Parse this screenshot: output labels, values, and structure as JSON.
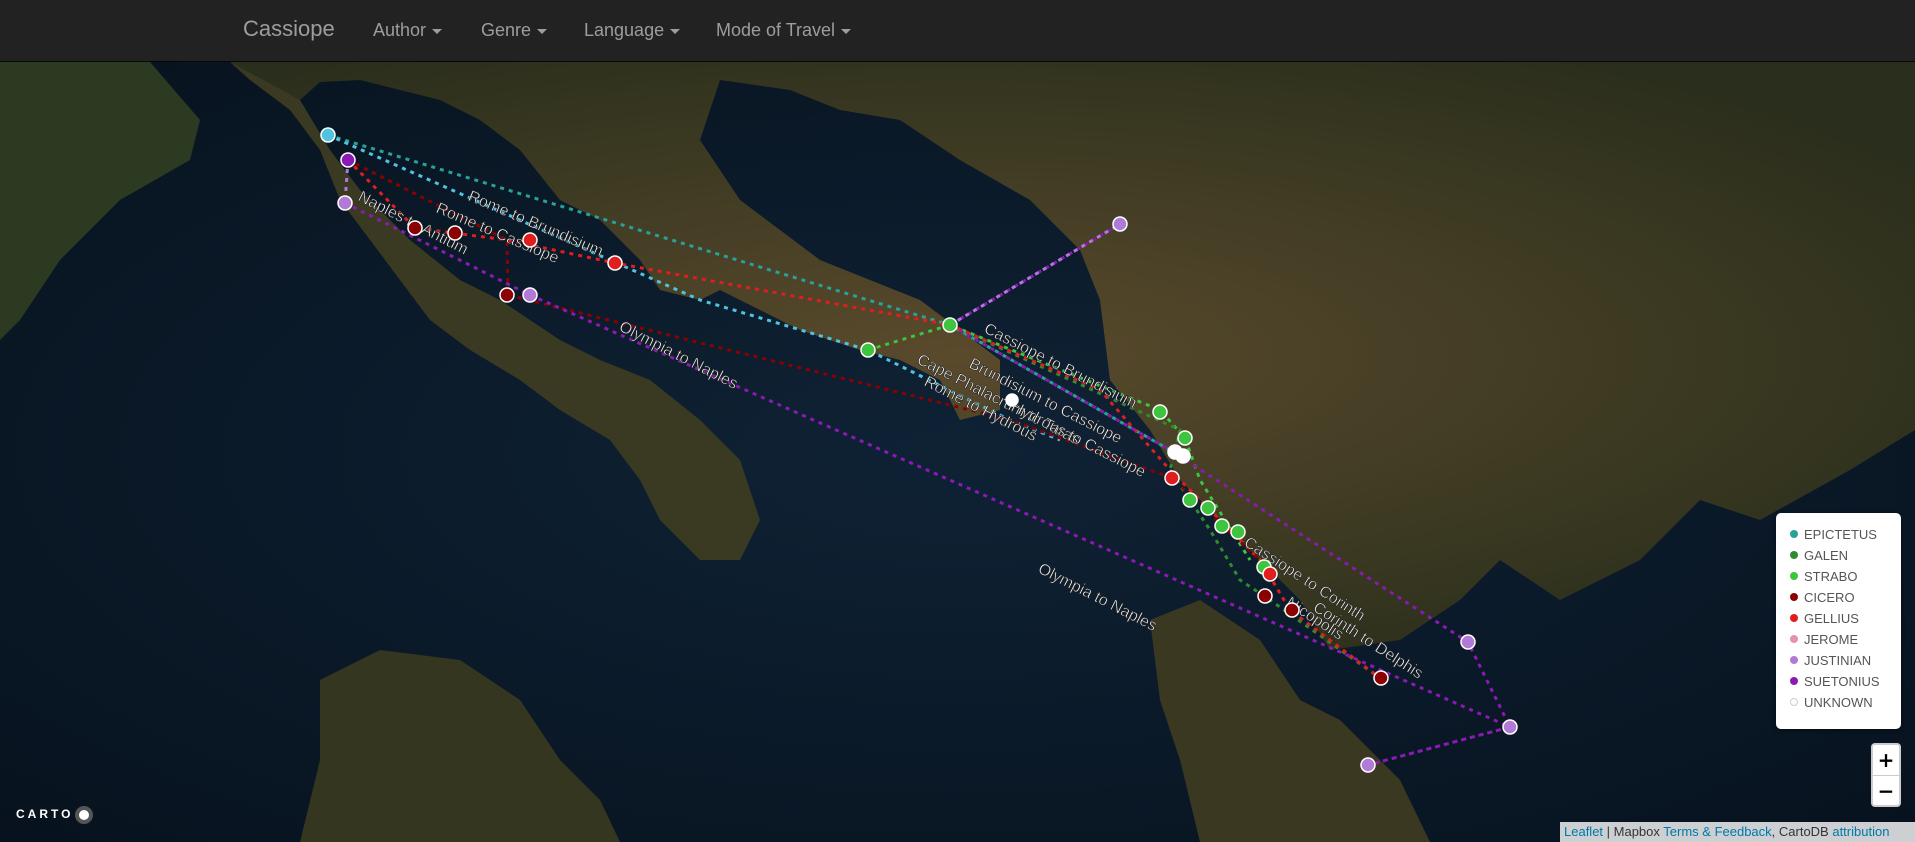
{
  "navbar": {
    "brand": "Cassiope",
    "menus": [
      {
        "label": "Author"
      },
      {
        "label": "Genre"
      },
      {
        "label": "Language"
      },
      {
        "label": "Mode of Travel"
      }
    ]
  },
  "map": {
    "route_labels": [
      "Rome to Brundisium",
      "Rome to Cassiope",
      "Naples to Antium",
      "Olympia to Naples",
      "Olympia to Naples",
      "Cassiope to Brundisium",
      "Brundisium to Cassiope",
      "Cape Phalacrum to Taras",
      "Rome to Hydrous",
      "Hydrous to Cassiope",
      "Cassiope to Corinth",
      "Corinth to Delphis",
      "Nicopolis"
    ],
    "author_colors": {
      "EPICTETUS": "#2aa198",
      "GALEN": "#2e8b2e",
      "STRABO": "#3ec43e",
      "CICERO": "#8b0000",
      "GELLIUS": "#e01e1e",
      "JEROME": "#e58fb4",
      "JUSTINIAN": "#b07ad6",
      "SUETONIUS": "#8a1ab3",
      "UNKNOWN": "#ffffff"
    }
  },
  "legend": {
    "items": [
      {
        "label": "EPICTETUS",
        "color": "#2aa198"
      },
      {
        "label": "GALEN",
        "color": "#2e8b2e"
      },
      {
        "label": "STRABO",
        "color": "#3ec43e"
      },
      {
        "label": "CICERO",
        "color": "#8b0000"
      },
      {
        "label": "GELLIUS",
        "color": "#e01e1e"
      },
      {
        "label": "JEROME",
        "color": "#e58fb4"
      },
      {
        "label": "JUSTINIAN",
        "color": "#b07ad6"
      },
      {
        "label": "SUETONIUS",
        "color": "#8a1ab3"
      },
      {
        "label": "UNKNOWN",
        "color": "#ffffff"
      }
    ]
  },
  "zoom": {
    "in": "+",
    "out": "−"
  },
  "attribution": {
    "leaflet": "Leaflet",
    "sep": " | Mapbox ",
    "terms": "Terms & Feedback",
    "mid": ", CartoDB ",
    "attribution": "attribution"
  },
  "carto": {
    "logo": "CARTO"
  }
}
